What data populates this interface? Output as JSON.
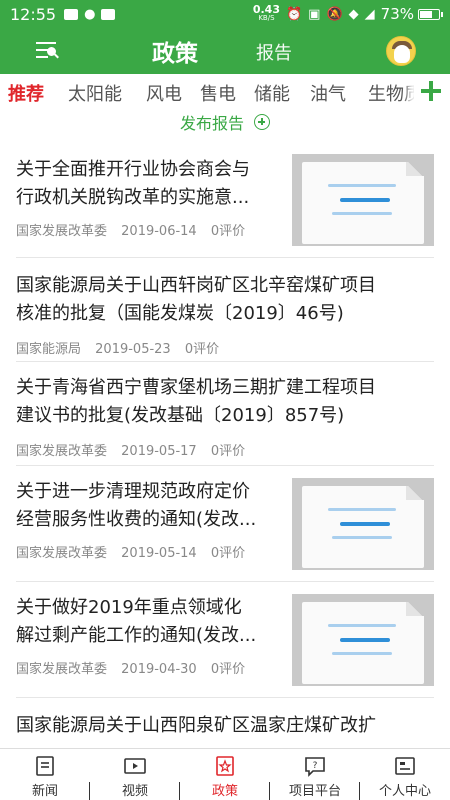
{
  "status_bar": {
    "time": "12:55",
    "net_speed_value": "0.43",
    "net_speed_unit": "KB/S",
    "battery": "73%",
    "battery_level": 0.73
  },
  "header": {
    "active_tab": "政策",
    "other_tab": "报告"
  },
  "categories": [
    "推荐",
    "太阳能",
    "风电",
    "售电",
    "储能",
    "油气",
    "生物质"
  ],
  "publish_label": "发布报告",
  "articles": [
    {
      "title_lines": [
        "关于全面推开行业协会商会与",
        "行政机关脱钩改革的实施意..."
      ],
      "source": "国家发展改革委",
      "date": "2019-06-14",
      "comments": "0评价",
      "has_thumb": true
    },
    {
      "title_lines": [
        "国家能源局关于山西轩岗矿区北辛窑煤矿项目",
        "核准的批复（国能发煤炭〔2019〕46号)"
      ],
      "source": "国家能源局",
      "date": "2019-05-23",
      "comments": "0评价",
      "has_thumb": false
    },
    {
      "title_lines": [
        "关于青海省西宁曹家堡机场三期扩建工程项目",
        "建议书的批复(发改基础〔2019〕857号)"
      ],
      "source": "国家发展改革委",
      "date": "2019-05-17",
      "comments": "0评价",
      "has_thumb": false
    },
    {
      "title_lines": [
        "关于进一步清理规范政府定价",
        "经营服务性收费的通知(发改..."
      ],
      "source": "国家发展改革委",
      "date": "2019-05-14",
      "comments": "0评价",
      "has_thumb": true
    },
    {
      "title_lines": [
        "关于做好2019年重点领域化",
        "解过剩产能工作的通知(发改..."
      ],
      "source": "国家发展改革委",
      "date": "2019-04-30",
      "comments": "0评价",
      "has_thumb": true
    },
    {
      "title_lines": [
        "国家能源局关于山西阳泉矿区温家庄煤矿改扩"
      ],
      "source": "",
      "date": "",
      "comments": "",
      "has_thumb": false
    }
  ],
  "bottom_nav": [
    {
      "label": "新闻",
      "icon": "news-icon"
    },
    {
      "label": "视频",
      "icon": "video-icon"
    },
    {
      "label": "政策",
      "icon": "policy-icon",
      "active": true
    },
    {
      "label": "项目平台",
      "icon": "project-icon"
    },
    {
      "label": "个人中心",
      "icon": "profile-icon"
    }
  ]
}
